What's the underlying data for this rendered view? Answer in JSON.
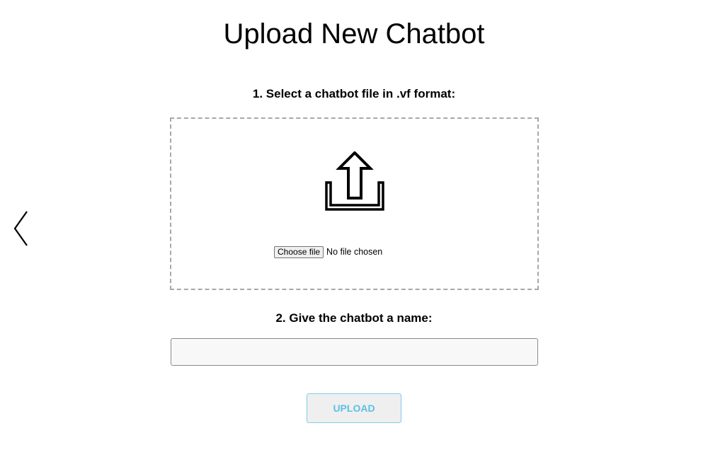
{
  "page": {
    "title": "Upload New Chatbot"
  },
  "nav": {
    "back_icon": "chevron-left-icon"
  },
  "step1": {
    "label": "1. Select a chatbot file in .vf format:",
    "icon": "upload-icon",
    "file_button_label": "Choose file",
    "file_status": "No file chosen"
  },
  "step2": {
    "label": "2. Give the chatbot a name:",
    "name_value": "",
    "name_placeholder": ""
  },
  "actions": {
    "upload_label": "UPLOAD"
  },
  "colors": {
    "upload_text": "#5bc0e4",
    "upload_border": "#7fcde8",
    "dropzone_border": "#a8a8a8"
  }
}
